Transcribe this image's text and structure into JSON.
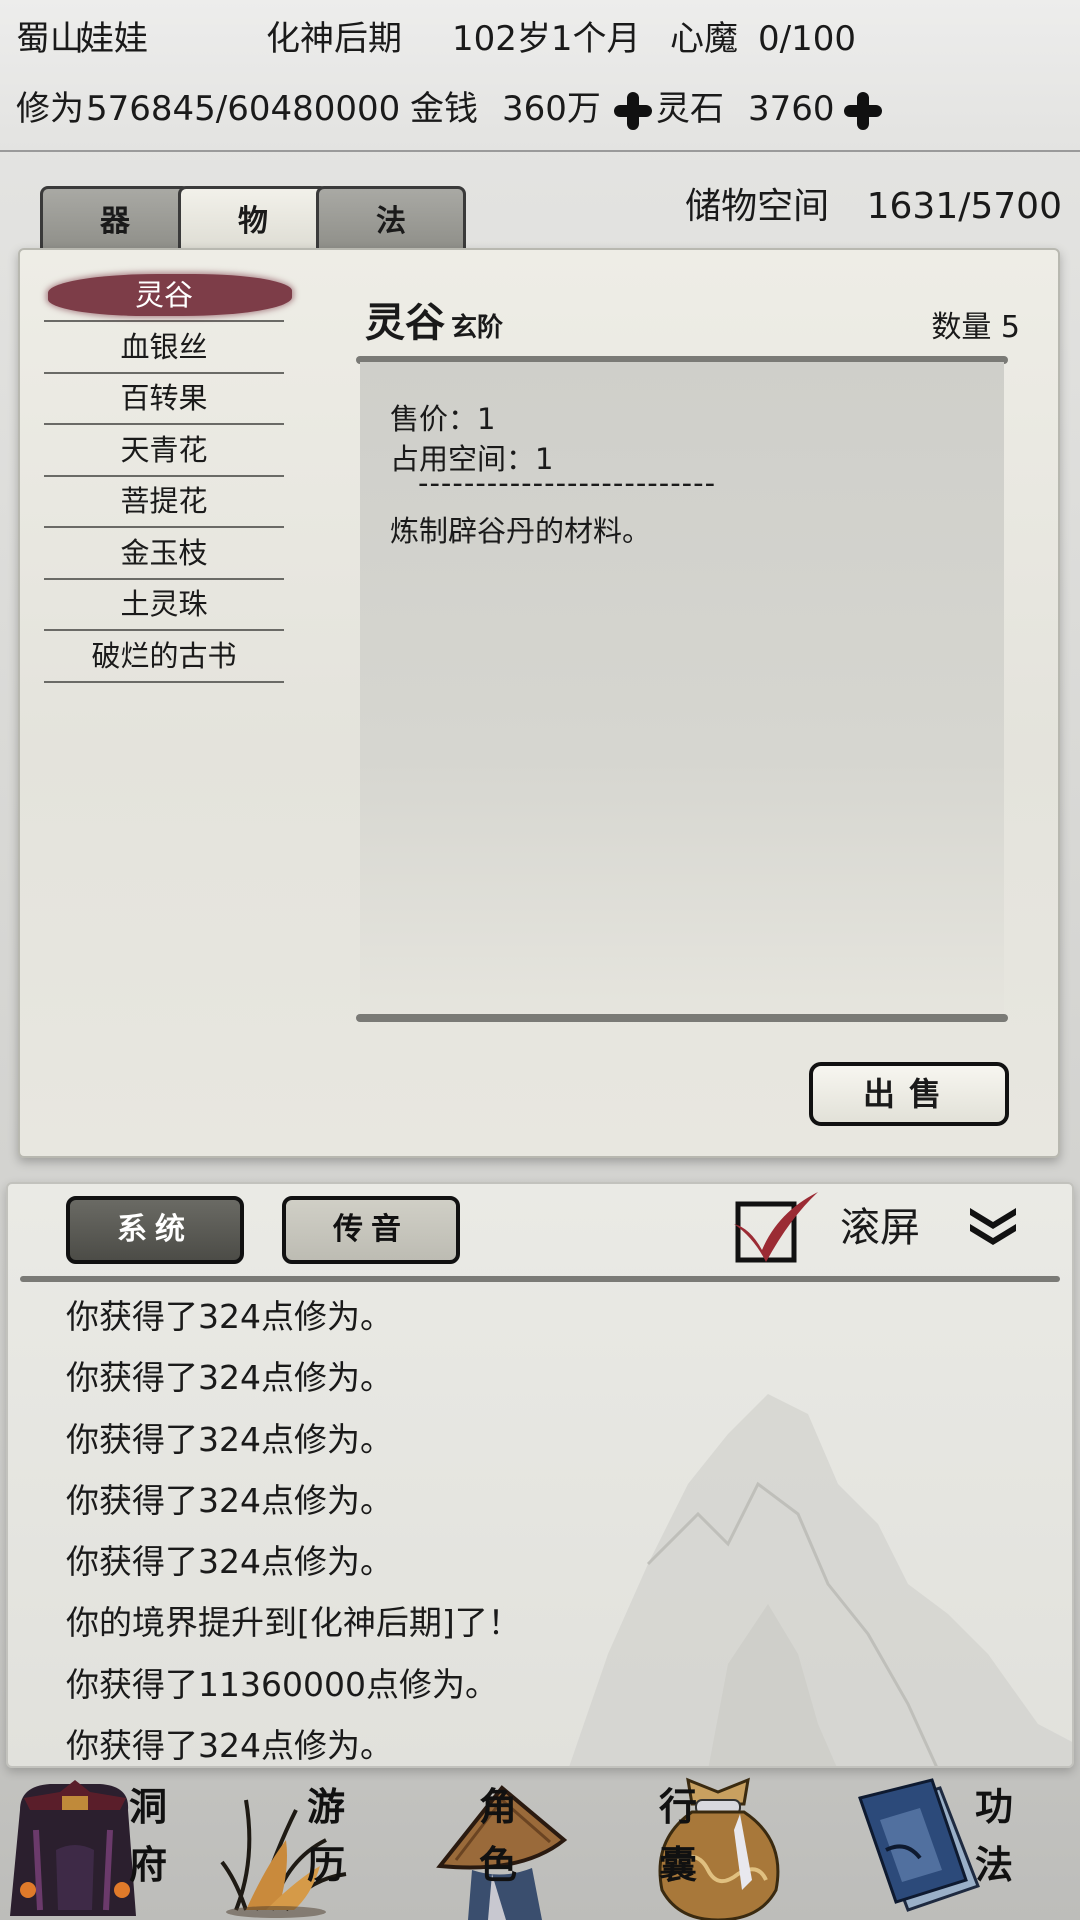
{
  "header": {
    "sect": "蜀山",
    "name": "娃娃",
    "realm": "化神后期",
    "age": "102岁1个月",
    "heart_demon_label": "心魔",
    "heart_demon_value": "0/100",
    "cultivation_label": "修为",
    "cultivation_value": "576845/60480000",
    "money_label": "金钱",
    "money_value": "360万",
    "spirit_stone_label": "灵石",
    "spirit_stone_value": "3760"
  },
  "tabs": [
    {
      "label": "器",
      "active": false
    },
    {
      "label": "物",
      "active": true
    },
    {
      "label": "法",
      "active": false
    }
  ],
  "storage": {
    "label": "储物空间",
    "value": "1631/5700"
  },
  "items": [
    "灵谷",
    "血银丝",
    "百转果",
    "天青花",
    "菩提花",
    "金玉枝",
    "土灵珠",
    "破烂的古书"
  ],
  "detail": {
    "name": "灵谷",
    "grade": "玄阶",
    "quantity": "数量 5",
    "price": "售价：1",
    "space": "占用空间：1",
    "separator": "--------------------------",
    "description": "炼制辟谷丹的材料。"
  },
  "sell_button": "出售",
  "chat": {
    "tab_system": "系统",
    "tab_voice": "传音",
    "scroll_label": "滚屏",
    "scroll_checked": true,
    "messages": [
      "你获得了324点修为。",
      "你获得了324点修为。",
      "你获得了324点修为。",
      "你获得了324点修为。",
      "你获得了324点修为。",
      "你的境界提升到[化神后期]了！",
      "你获得了11360000点修为。",
      "你获得了324点修为。"
    ]
  },
  "nav": [
    {
      "label_top": "洞",
      "label_bottom": "府",
      "icon": "cave-gate-icon"
    },
    {
      "label_top": "游",
      "label_bottom": "历",
      "icon": "grass-wander-icon"
    },
    {
      "label_top": "角",
      "label_bottom": "色",
      "icon": "straw-hat-icon"
    },
    {
      "label_top": "行",
      "label_bottom": "囊",
      "icon": "pouch-bag-icon"
    },
    {
      "label_top": "功",
      "label_bottom": "法",
      "icon": "book-scroll-icon"
    }
  ],
  "colors": {
    "selected_item": "#7d3d48",
    "check_mark": "#9b2b34",
    "ink": "#111111",
    "paper": "#eeede6"
  }
}
